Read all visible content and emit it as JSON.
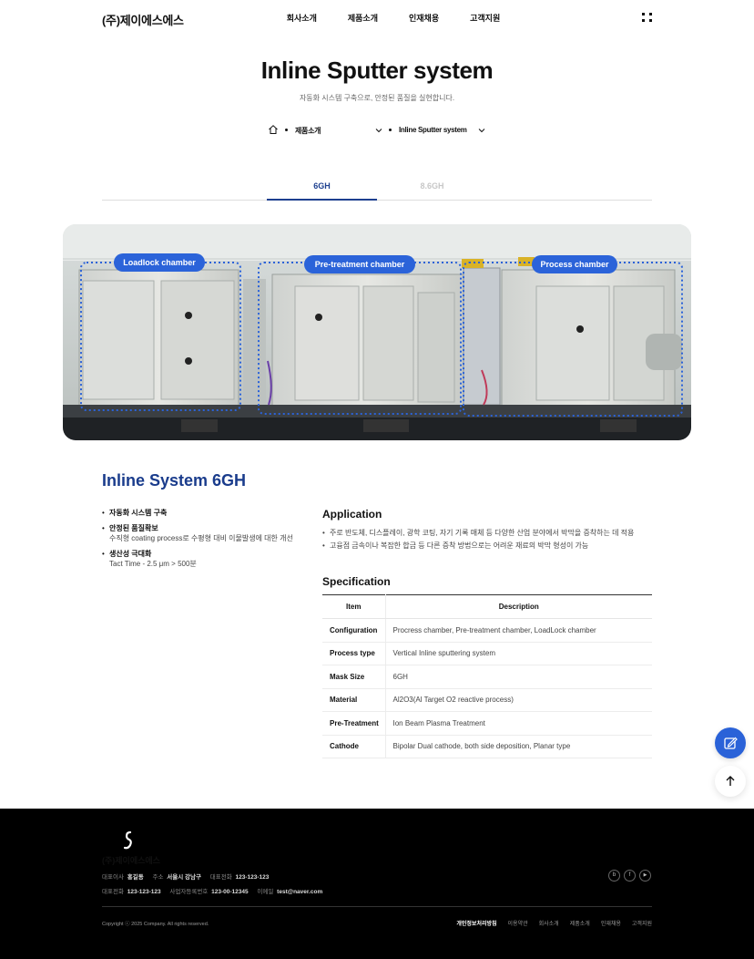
{
  "header": {
    "logo": "(주)제이에스에스",
    "nav": [
      "회사소개",
      "제품소개",
      "인재채용",
      "고객지원"
    ]
  },
  "page": {
    "title": "Inline Sputter system",
    "subtitle": "자동화 시스템 구축으로, 안정된 품질을 실현합니다."
  },
  "breadcrumb": {
    "level1": "제품소개",
    "level2": "Inline Sputter system"
  },
  "tabs": [
    {
      "label": "6GH",
      "active": true
    },
    {
      "label": "8.6GH",
      "active": false
    }
  ],
  "hero": {
    "labels": [
      "Loadlock chamber",
      "Pre-treatment chamber",
      "Process chamber"
    ]
  },
  "product": {
    "title": "Inline System 6GH",
    "features": [
      {
        "title": "자동화 시스템 구축",
        "desc": ""
      },
      {
        "title": "안정된 품질확보",
        "desc": "수직형 coating process로 수평형 대비 이물발생에 대한 개선"
      },
      {
        "title": "생산성 극대화",
        "desc": "Tact Time - 2.5 μm > 500분"
      }
    ],
    "application_heading": "Application",
    "applications": [
      "주로 반도체, 디스플레이, 광학 코팅, 자기 기록 매체 등 다양한 산업 분야에서 박막을 증착하는 데 적용",
      "고융점 금속이나 복잡한 합금 등 다른 증착 방법으로는 어려운 재료의 박막 형성이 가능"
    ],
    "spec_heading": "Specification",
    "spec_headers": {
      "item": "Item",
      "desc": "Description"
    },
    "specs": [
      {
        "item": "Configuration",
        "desc": "Procress chamber, Pre-treatment chamber, LoadLock chamber"
      },
      {
        "item": "Process type",
        "desc": "Vertical Inline sputtering system"
      },
      {
        "item": "Mask Size",
        "desc": "6GH"
      },
      {
        "item": "Material",
        "desc": "Al2O3(Al Target O2 reactive process)"
      },
      {
        "item": "Pre-Treatment",
        "desc": "Ion Beam Plasma Treatment"
      },
      {
        "item": "Cathode",
        "desc": "Bipolar Dual cathode, both side deposition, Planar type"
      }
    ]
  },
  "footer": {
    "logo": "(주)제이에스에스",
    "ceo_label": "대표이사",
    "ceo": "홍길동",
    "addr_label": "주소",
    "addr": "서울시 강남구",
    "tel_label": "대표전화",
    "tel": "123-123-123",
    "tel2_label": "대표전화",
    "tel2": "123-123-123",
    "biz_label": "사업자등록번호",
    "biz": "123-00-12345",
    "email_label": "이메일",
    "email": "test@naver.com",
    "copyright": "Copyright ⓒ 2025 Company. All rights reserved.",
    "links": [
      "개인정보처리방침",
      "이용약관",
      "회사소개",
      "제품소개",
      "인재채용",
      "고객지원"
    ],
    "social": [
      "b",
      "f",
      "▶"
    ]
  },
  "colors": {
    "brand": "#1a3c8c",
    "accent": "#2b63d9",
    "footer": "#000000"
  }
}
